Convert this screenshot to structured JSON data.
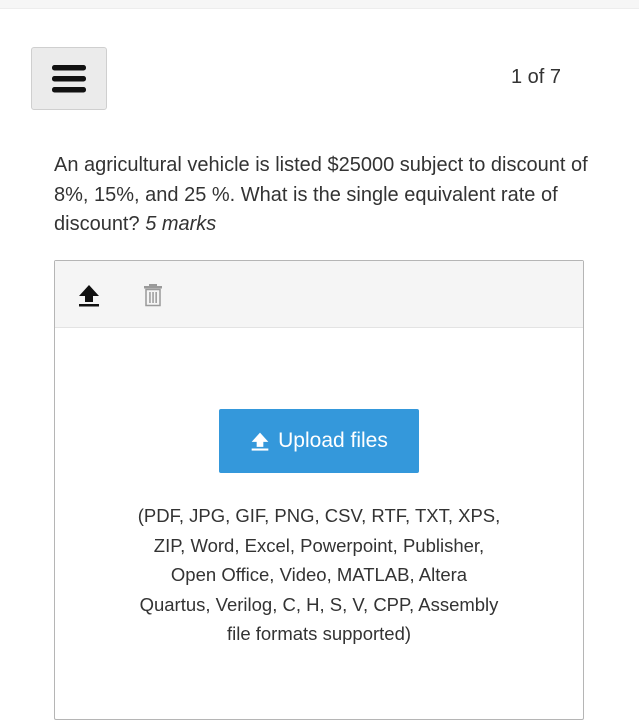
{
  "header": {
    "menu_icon": "hamburger-menu-icon",
    "pager_text": "1 of 7"
  },
  "question": {
    "text": "An agricultural vehicle is listed $25000 subject to discount of 8%, 15%, and 25 %. What is the single equivalent rate of discount?",
    "marks": "5 marks"
  },
  "upload": {
    "toolbar": {
      "upload_icon": "upload-arrow-icon",
      "delete_icon": "trash-icon"
    },
    "button_label": "Upload files",
    "button_icon": "upload-arrow-icon",
    "formats_lines": [
      "(PDF, JPG, GIF, PNG, CSV, RTF, TXT, XPS,",
      "ZIP, Word, Excel, Powerpoint, Publisher,",
      "Open Office, Video, MATLAB, Altera",
      "Quartus, Verilog, C, H, S, V, CPP, Assembly",
      "file formats supported)"
    ]
  },
  "colors": {
    "primary_button": "#3498db",
    "text": "#333333",
    "menu_button_bg": "#ebebeb",
    "toolbar_bg": "#f5f5f5"
  }
}
